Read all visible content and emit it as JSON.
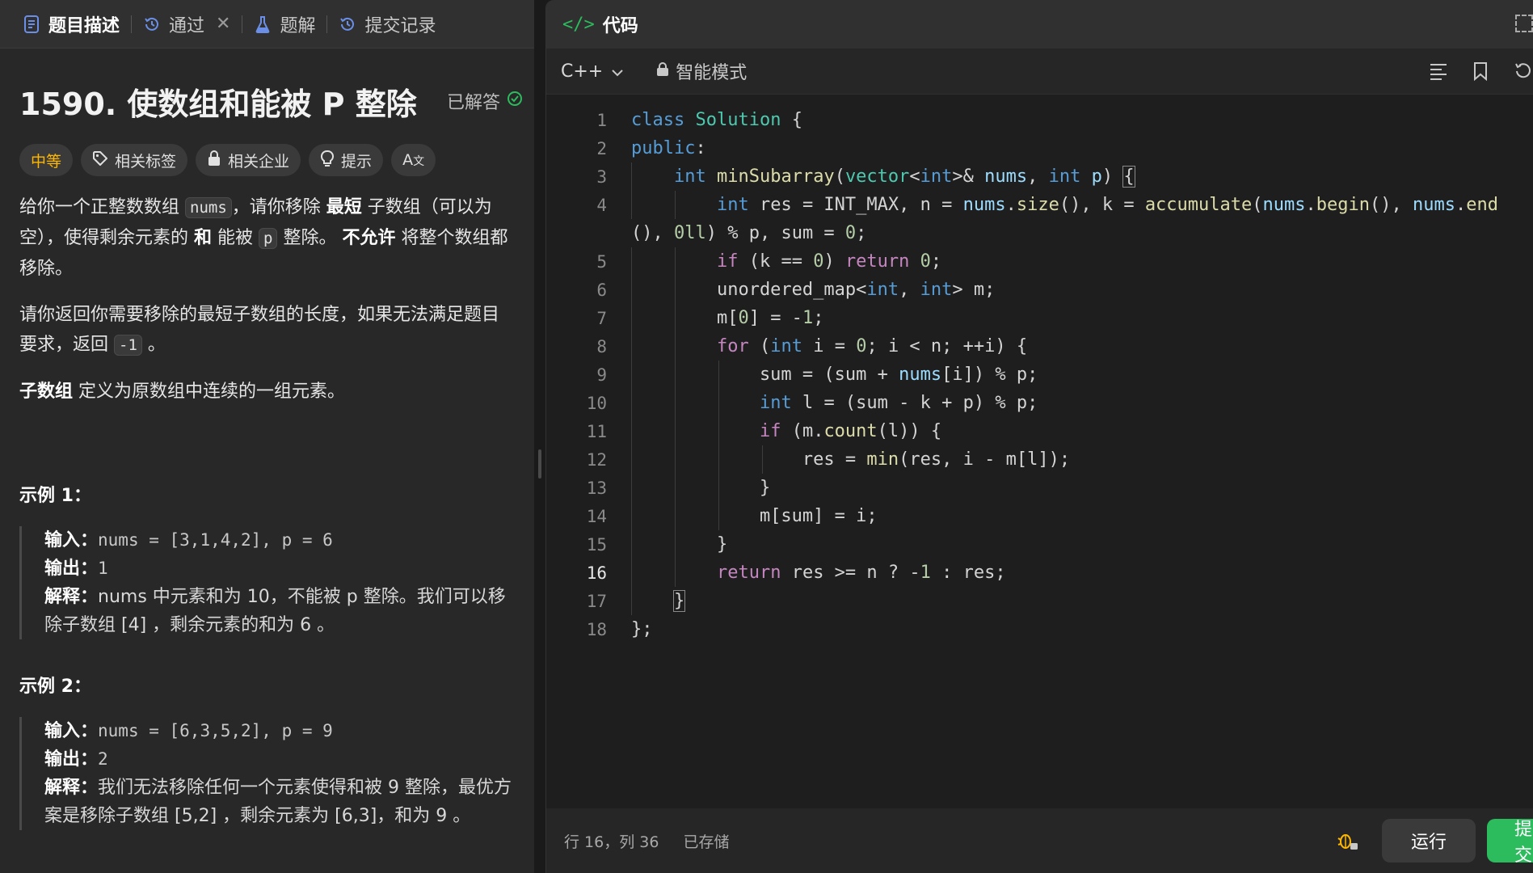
{
  "left_tabs": [
    {
      "label": "题目描述",
      "icon": "document-icon"
    },
    {
      "label": "通过",
      "icon": "history-icon"
    },
    {
      "label": "题解",
      "icon": "flask-icon"
    },
    {
      "label": "提交记录",
      "icon": "history-icon"
    }
  ],
  "problem": {
    "title": "1590. 使数组和能被 P 整除",
    "status": "已解答",
    "tags": {
      "difficulty": "中等",
      "related_tags": "相关标签",
      "related_companies": "相关企业",
      "hints": "提示"
    },
    "desc1": {
      "a": "给你一个正整数数组 ",
      "code1": "nums",
      "b": "，请你移除 ",
      "bold1": "最短",
      "c": " 子数组（可以为空），使得剩余元素的 ",
      "bold2": "和",
      "d": " 能被 ",
      "code2": "p",
      "e": " 整除。 ",
      "bold3": "不允许",
      "f": " 将整个数组都移除。"
    },
    "desc2": {
      "a": "请你返回你需要移除的最短子数组的长度，如果无法满足题目要求，返回 ",
      "code": "-1",
      "b": " 。"
    },
    "desc3": {
      "bold": "子数组",
      "a": " 定义为原数组中连续的一组元素。"
    },
    "examples": [
      {
        "title": "示例 1：",
        "input_label": "输入：",
        "input": "nums = [3,1,4,2], p = 6",
        "output_label": "输出：",
        "output": "1",
        "explain_label": "解释：",
        "explain": "nums 中元素和为 10，不能被 p 整除。我们可以移除子数组 [4] ，剩余元素的和为 6 。"
      },
      {
        "title": "示例 2：",
        "input_label": "输入：",
        "input": "nums = [6,3,5,2], p = 9",
        "output_label": "输出：",
        "output": "2",
        "explain_label": "解释：",
        "explain": "我们无法移除任何一个元素使得和被 9 整除，最优方案是移除子数组 [5,2] ，剩余元素为 [6,3]，和为 9 。"
      }
    ]
  },
  "editor": {
    "header_title": "代码",
    "language": "C++",
    "mode": "智能模式",
    "current_line": 16,
    "line_numbers": [
      "1",
      "2",
      "3",
      "4",
      "",
      "5",
      "6",
      "7",
      "8",
      "9",
      "10",
      "11",
      "12",
      "13",
      "14",
      "15",
      "16",
      "17",
      "18"
    ]
  },
  "status": {
    "position": "行 16，列 36",
    "saved": "已存储",
    "run": "运行",
    "submit": "提交"
  },
  "colors": {
    "accent_green": "#2cbb5d",
    "difficulty_medium": "#ffb800",
    "solved_green": "#2cbb5d",
    "tab_blue": "#6b8fe6"
  }
}
